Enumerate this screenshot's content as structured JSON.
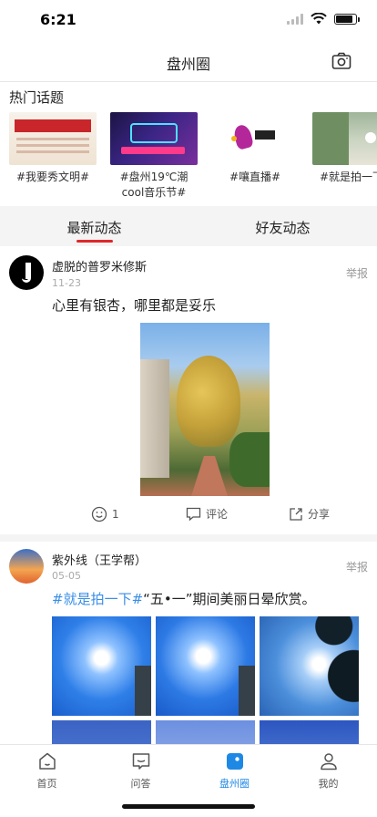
{
  "status_bar": {
    "time": "6:21"
  },
  "nav": {
    "title": "盘州圈",
    "camera_icon": "camera-icon"
  },
  "hot_topics": {
    "title": "热门话题",
    "items": [
      {
        "label": "#我要秀文明#"
      },
      {
        "label": "#盘州19℃潮cool音乐节#"
      },
      {
        "label": "#嚷直播#"
      },
      {
        "label": "#就是拍一下#"
      }
    ]
  },
  "feed_tabs": [
    {
      "label": "最新动态",
      "active": true
    },
    {
      "label": "好友动态",
      "active": false
    }
  ],
  "posts": [
    {
      "username": "虚脱的普罗米修斯",
      "date": "11-23",
      "report_label": "举报",
      "content": "心里有银杏，哪里都是妥乐",
      "actions": {
        "like_count": "1",
        "comment_label": "评论",
        "share_label": "分享"
      }
    },
    {
      "username": "紫外线（王学帮）",
      "date": "05-05",
      "report_label": "举报",
      "hashtag": "#就是拍一下#",
      "content": "“五•一”期间美丽日晕欣赏。"
    }
  ],
  "tabbar": [
    {
      "label": "首页",
      "icon": "home-icon",
      "active": false
    },
    {
      "label": "问答",
      "icon": "qa-icon",
      "active": false
    },
    {
      "label": "盘州圈",
      "icon": "circle-icon",
      "active": true
    },
    {
      "label": "我的",
      "icon": "profile-icon",
      "active": false
    }
  ],
  "colors": {
    "accent": "#e0282b",
    "link": "#3a8ee6",
    "tab_active": "#1e88e5"
  }
}
